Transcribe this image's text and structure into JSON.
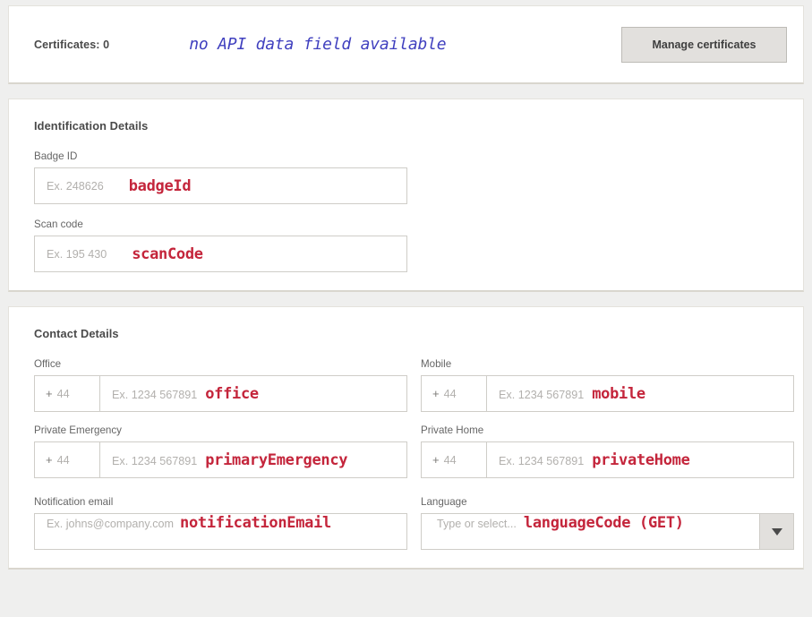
{
  "certificates_card": {
    "label": "Certificates: 0",
    "api_note": "no API data field available",
    "manage_button": "Manage certificates"
  },
  "identification": {
    "title": "Identification Details",
    "fields": [
      {
        "label": "Badge ID",
        "placeholder": "Ex. 248626",
        "annotation": "badgeId"
      },
      {
        "label": "Scan code",
        "placeholder": "Ex. 195 430",
        "annotation": "scanCode"
      }
    ]
  },
  "contact": {
    "title": "Contact Details",
    "phone_fields": [
      {
        "label": "Office",
        "country_plus": "+",
        "country_code": "44",
        "placeholder": "Ex. 1234 567891",
        "annotation": "office"
      },
      {
        "label": "Mobile",
        "country_plus": "+",
        "country_code": "44",
        "placeholder": "Ex. 1234 567891",
        "annotation": "mobile"
      },
      {
        "label": "Private Emergency",
        "country_plus": "+",
        "country_code": "44",
        "placeholder": "Ex. 1234 567891",
        "annotation": "primaryEmergency"
      },
      {
        "label": "Private Home",
        "country_plus": "+",
        "country_code": "44",
        "placeholder": "Ex. 1234 567891",
        "annotation": "privateHome"
      }
    ],
    "email_field": {
      "label": "Notification email",
      "placeholder": "Ex. johns@company.com",
      "annotation": "notificationEmail"
    },
    "language_field": {
      "label": "Language",
      "placeholder": "Type or select...",
      "annotation": "languageCode (GET)",
      "dropdown_icon": "chevron-down-icon"
    }
  },
  "colors": {
    "annotation_red": "#c4253b",
    "api_note_blue": "#4040bf",
    "page_background": "#efefee",
    "card_background": "#ffffff",
    "button_gray": "#e2e0dd"
  }
}
